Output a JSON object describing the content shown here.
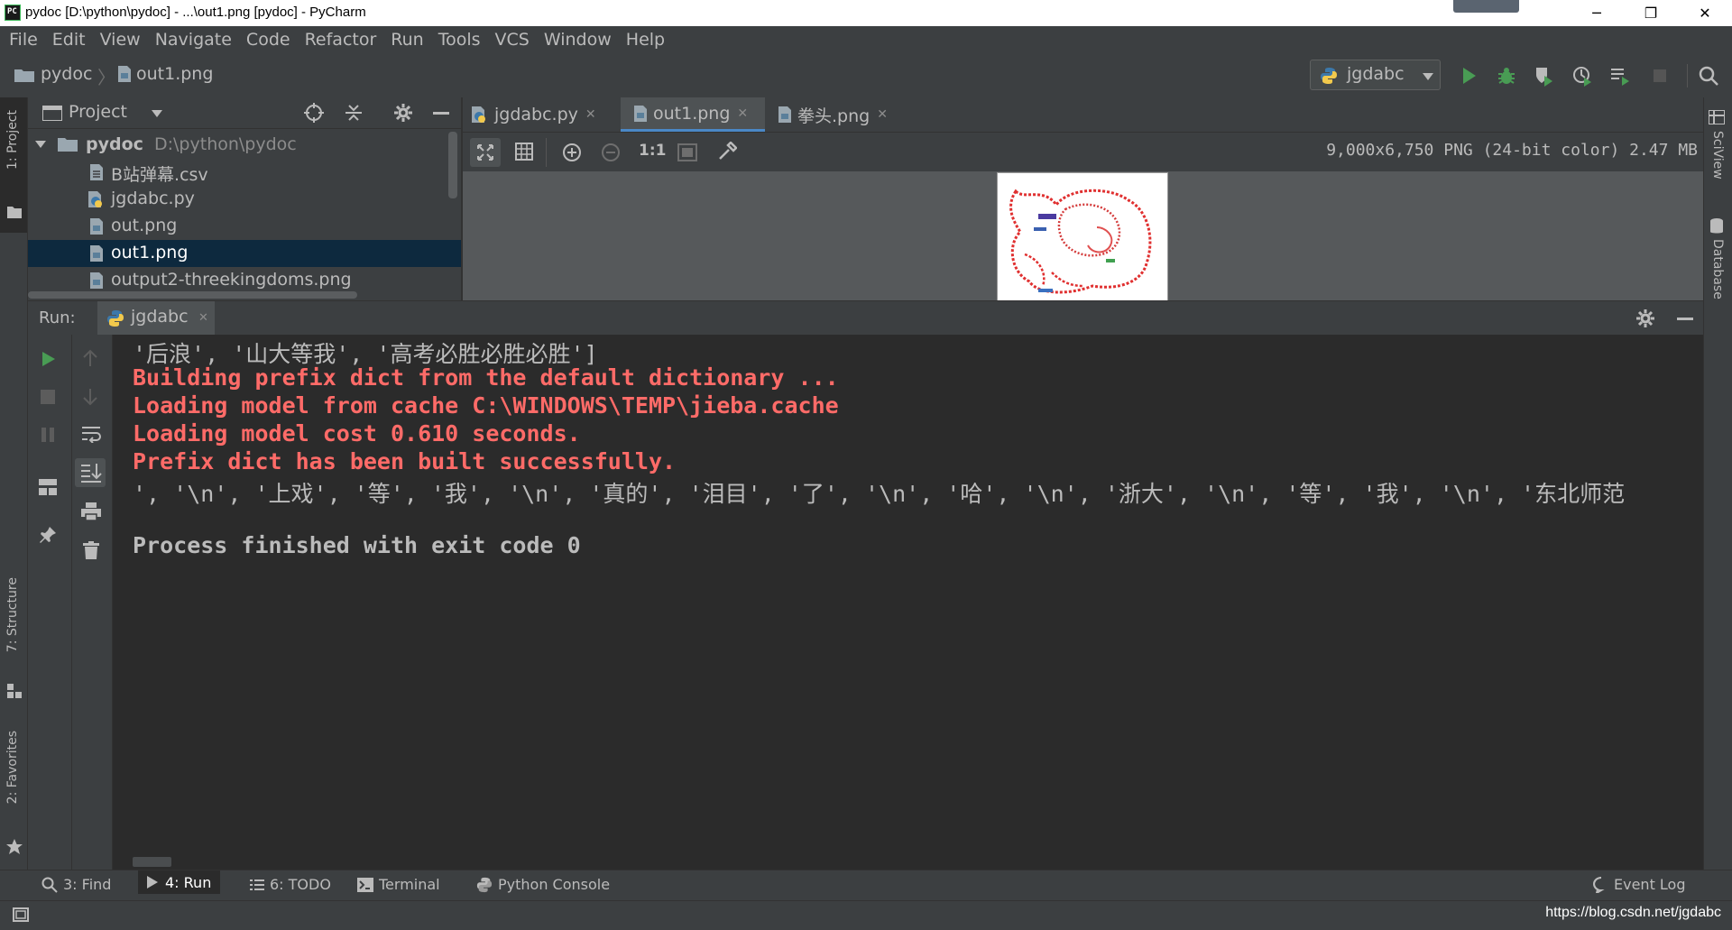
{
  "titlebar": {
    "title": "pydoc [D:\\python\\pydoc] - ...\\out1.png [pydoc] - PyCharm",
    "minimize": "─",
    "restore": "❐",
    "close": "✕"
  },
  "menu": [
    "File",
    "Edit",
    "View",
    "Navigate",
    "Code",
    "Refactor",
    "Run",
    "Tools",
    "VCS",
    "Window",
    "Help"
  ],
  "breadcrumb": {
    "project": "pydoc",
    "file": "out1.png"
  },
  "run_config": {
    "label": "jgdabc"
  },
  "left_stripe": {
    "project": "1: Project",
    "structure": "7: Structure",
    "favorites": "2: Favorites"
  },
  "right_stripe": {
    "sciview": "SciView",
    "database": "Database"
  },
  "project_panel": {
    "title": "Project",
    "root": {
      "name": "pydoc",
      "path": "D:\\python\\pydoc"
    },
    "files": [
      {
        "name": "B站弹幕.csv",
        "selected": false
      },
      {
        "name": "jgdabc.py",
        "selected": false
      },
      {
        "name": "out.png",
        "selected": false
      },
      {
        "name": "out1.png",
        "selected": true
      },
      {
        "name": "output2-threekingdoms.png",
        "selected": false
      }
    ]
  },
  "editor_tabs": [
    {
      "label": "jgdabc.py",
      "active": false
    },
    {
      "label": "out1.png",
      "active": true
    },
    {
      "label": "拳头.png",
      "active": false
    }
  ],
  "image_info": "9,000x6,750 PNG (24-bit color) 2.47 MB",
  "image_toolbar": {
    "actual_size": "1:1"
  },
  "run_panel": {
    "label": "Run:",
    "tab": "jgdabc",
    "console": [
      {
        "kind": "out",
        "text": "'后浪', '山大等我', '高考必胜必胜必胜']"
      },
      {
        "kind": "err",
        "text": "Building prefix dict from the default dictionary ..."
      },
      {
        "kind": "err",
        "text": "Loading model from cache C:\\WINDOWS\\TEMP\\jieba.cache"
      },
      {
        "kind": "err",
        "text": "Loading model cost 0.610 seconds."
      },
      {
        "kind": "err",
        "text": "Prefix dict has been built successfully."
      },
      {
        "kind": "out",
        "text": "', '\\n', '上戏', '等', '我', '\\n', '真的', '泪目', '了', '\\n', '哈', '\\n', '浙大', '\\n', '等', '我', '\\n', '东北师范"
      },
      {
        "kind": "out",
        "text": ""
      },
      {
        "kind": "fin",
        "text": "Process finished with exit code 0"
      }
    ]
  },
  "bottom_tools": [
    {
      "label": "3: Find",
      "active": false
    },
    {
      "label": "4: Run",
      "active": true
    },
    {
      "label": "6: TODO",
      "active": false
    },
    {
      "label": "Terminal",
      "active": false
    },
    {
      "label": "Python Console",
      "active": false
    }
  ],
  "event_log": "Event Log",
  "watermark": "https://blog.csdn.net/jgdabc",
  "colors": {
    "accent": "#4a88c7",
    "error": "#ff6b68",
    "run_green": "#4caf50",
    "debug_green": "#5db85b"
  },
  "icons": [
    "pycharm-logo-icon",
    "folder-icon",
    "image-file-icon",
    "python-file-icon",
    "run-icon",
    "debug-icon",
    "coverage-icon",
    "profile-icon",
    "concurrency-icon",
    "stop-icon",
    "search-icon",
    "gear-icon",
    "hide-icon",
    "locate-icon",
    "collapse-icon",
    "zoom-in-icon",
    "zoom-out-icon",
    "fit-icon",
    "grid-icon",
    "color-picker-icon"
  ]
}
